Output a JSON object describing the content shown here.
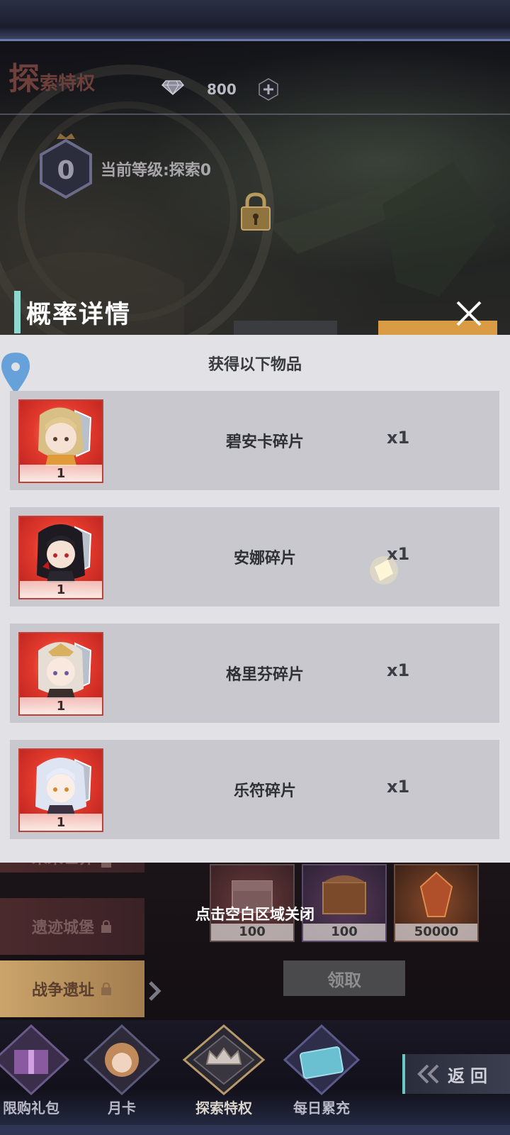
{
  "header": {
    "title_first_char": "探",
    "title_rest": "索特权",
    "gems_value": "800",
    "level_number": "0",
    "level_text": "当前等级:探索0"
  },
  "modal": {
    "title": "概率详情",
    "subtitle": "获得以下物品",
    "items": [
      {
        "name": "碧安卡碎片",
        "count": "1",
        "qty": "x1"
      },
      {
        "name": "安娜碎片",
        "count": "1",
        "qty": "x1"
      },
      {
        "name": "格里芬碎片",
        "count": "1",
        "qty": "x1"
      },
      {
        "name": "乐符碎片",
        "count": "1",
        "qty": "x1"
      }
    ]
  },
  "background_menu": {
    "side_items": [
      {
        "label": "未来世界"
      },
      {
        "label": "遗迹城堡"
      },
      {
        "label": "战争遗址"
      }
    ],
    "rewards": [
      "100",
      "100",
      "50000"
    ],
    "claim_label": "领取",
    "close_hint": "点击空白区域关闭"
  },
  "bottom_nav": {
    "tabs": [
      {
        "label": "限购礼包"
      },
      {
        "label": "月卡"
      },
      {
        "label": "探索特权"
      },
      {
        "label": "每日累充"
      }
    ],
    "back_label": "返回"
  },
  "colors": {
    "accent_teal": "#8fd8d0",
    "card_red": "#e1392c",
    "panel_bg": "#e2e1e6",
    "row_bg": "#c9c8cf"
  }
}
